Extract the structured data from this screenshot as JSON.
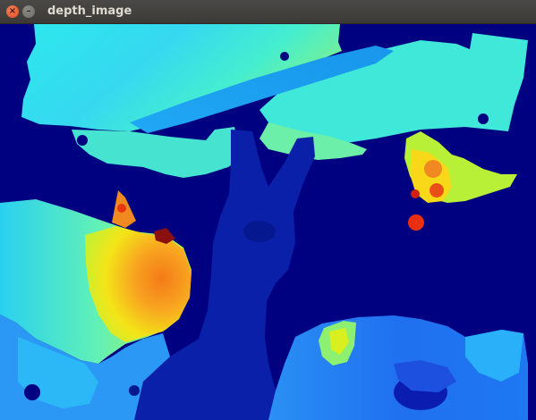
{
  "window": {
    "title": "depth_image",
    "close_glyph": "×",
    "minimize_glyph": "–"
  },
  "image": {
    "kind": "depth colormap (jet)",
    "colors": {
      "background": "#000180",
      "far_blue": "#0a1db0",
      "hand": "#0a20a8",
      "blue": "#1e6bf0",
      "light_blue": "#2aa8f8",
      "cyan": "#2de0f0",
      "aqua": "#4af0c8",
      "green": "#8ef070",
      "yellow": "#f8f018",
      "orange": "#f8a020",
      "red": "#e83010",
      "dark_red": "#8a1010"
    }
  }
}
